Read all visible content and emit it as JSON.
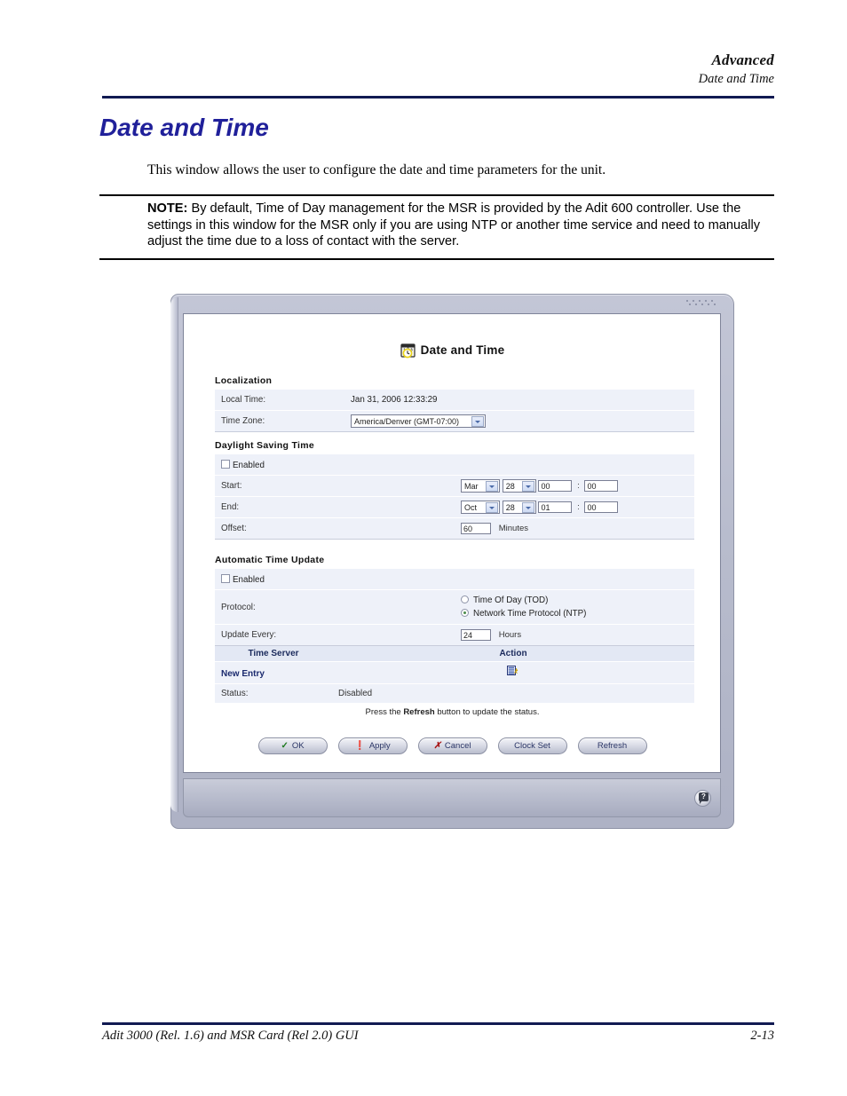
{
  "page": {
    "header_title": "Advanced",
    "header_subtitle": "Date and Time",
    "title": "Date and Time",
    "intro": "This window allows the user to configure the date and time parameters for the unit.",
    "note_label": "NOTE:",
    "note_text": " By default, Time of Day management for the MSR is provided by the Adit 600 controller.  Use the settings in this window for the MSR only if you are using NTP or another time service and need to manually adjust the time due to a loss of contact with the server.",
    "footer_left": "Adit 3000 (Rel. 1.6) and MSR Card (Rel 2.0) GUI",
    "footer_right": "2-13"
  },
  "window": {
    "breadcrumb": "Advanced -> Date and Time",
    "form_title": "Date and Time",
    "toolbar": {
      "network_icon": "network-tree-icon",
      "list_icon": "list-view-icon"
    },
    "help_glyph": "?"
  },
  "localization": {
    "heading": "Localization",
    "local_time_label": "Local Time:",
    "local_time_value": "Jan 31, 2006 12:33:29",
    "time_zone_label": "Time Zone:",
    "time_zone_value": "America/Denver (GMT-07:00)"
  },
  "dst": {
    "heading": "Daylight Saving Time",
    "enabled_label": "Enabled",
    "enabled_checked": false,
    "start_label": "Start:",
    "start_month": "Mar",
    "start_day": "28",
    "start_hour": "00",
    "start_minute": "00",
    "end_label": "End:",
    "end_month": "Oct",
    "end_day": "28",
    "end_hour": "01",
    "end_minute": "00",
    "offset_label": "Offset:",
    "offset_value": "60",
    "offset_unit": "Minutes",
    "time_separator": ":"
  },
  "auto_update": {
    "heading": "Automatic Time Update",
    "enabled_label": "Enabled",
    "enabled_checked": false,
    "protocol_label": "Protocol:",
    "protocol_tod": "Time Of Day (TOD)",
    "protocol_ntp": "Network Time Protocol (NTP)",
    "protocol_selected": "ntp",
    "update_every_label": "Update Every:",
    "update_every_value": "24",
    "update_every_unit": "Hours",
    "col_time_server": "Time Server",
    "col_action": "Action",
    "new_entry_label": "New Entry",
    "new_entry_action_icon": "add-entry-icon",
    "status_label": "Status:",
    "status_value": "Disabled",
    "hint_prefix": "Press the ",
    "hint_bold": "Refresh",
    "hint_suffix": " button to update the status."
  },
  "buttons": [
    {
      "label": "OK",
      "glyph": "check-icon"
    },
    {
      "label": "Apply",
      "glyph": "exclamation-icon"
    },
    {
      "label": "Cancel",
      "glyph": "x-icon"
    },
    {
      "label": "Clock Set",
      "glyph": ""
    },
    {
      "label": "Refresh",
      "glyph": ""
    }
  ],
  "colors": {
    "title_blue": "#20209a",
    "rule_navy": "#111a52",
    "crumb_green": "#33dd33",
    "row_bg": "#eef1f9",
    "link_navy": "#1b2a6e"
  }
}
